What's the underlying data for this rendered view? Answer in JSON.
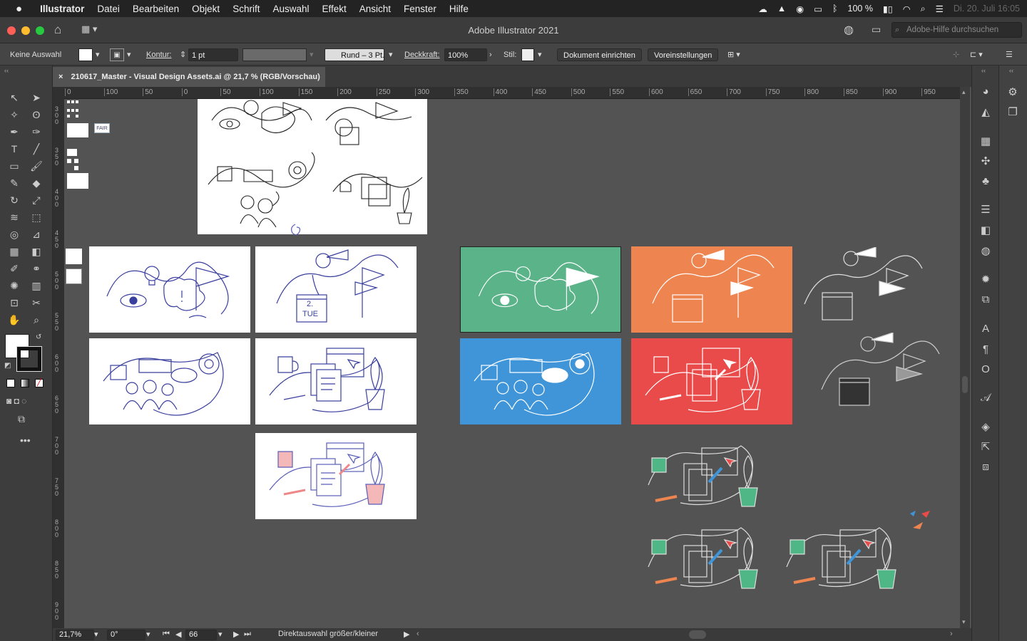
{
  "menubar": {
    "apple": "",
    "items": [
      "Illustrator",
      "Datei",
      "Bearbeiten",
      "Objekt",
      "Schrift",
      "Auswahl",
      "Effekt",
      "Ansicht",
      "Fenster",
      "Hilfe"
    ],
    "battery": "100 %",
    "datetime": "Di. 20. Juli  16:05"
  },
  "window": {
    "title": "Adobe Illustrator 2021",
    "help_placeholder": "Adobe-Hilfe durchsuchen"
  },
  "control": {
    "selection": "Keine Auswahl",
    "stroke_label": "Kontur:",
    "stroke_weight": "1 pt",
    "brush": "Rund – 3 Pt.",
    "opacity_label": "Deckkraft:",
    "opacity": "100%",
    "style_label": "Stil:",
    "doc_setup": "Dokument einrichten",
    "prefs": "Voreinstellungen"
  },
  "document": {
    "tab_title": "210617_Master - Visual Design Assets.ai @ 21,7 % (RGB/Vorschau)",
    "close": "×"
  },
  "ruler": {
    "h_ticks": [
      "0",
      "100",
      "50",
      "0",
      "50",
      "100",
      "150",
      "200",
      "250",
      "300",
      "350",
      "400",
      "450",
      "500",
      "550",
      "600",
      "650",
      "700",
      "750",
      "800",
      "850",
      "900",
      "950",
      "10"
    ],
    "v_ticks": [
      "3\n0\n0",
      "3\n5\n0",
      "4\n0\n0",
      "4\n5\n0",
      "5\n0\n0",
      "5\n5\n0",
      "6\n0\n0",
      "6\n5\n0",
      "7\n0\n0",
      "7\n5\n0",
      "8\n0\n0",
      "8\n5\n0",
      "9\n0\n0"
    ]
  },
  "status": {
    "zoom": "21,7%",
    "rotation": "0°",
    "artboard": "66",
    "hint": "Direktauswahl größer/kleiner"
  },
  "colors": {
    "green": "#5bb38a",
    "orange": "#ee8550",
    "blue": "#3f95d8",
    "red": "#e94a4a",
    "navy": "#3a3f9e"
  },
  "thumb_labels": {
    "fair": "FAIR",
    "day": "2.",
    "weekday": "TUE"
  }
}
